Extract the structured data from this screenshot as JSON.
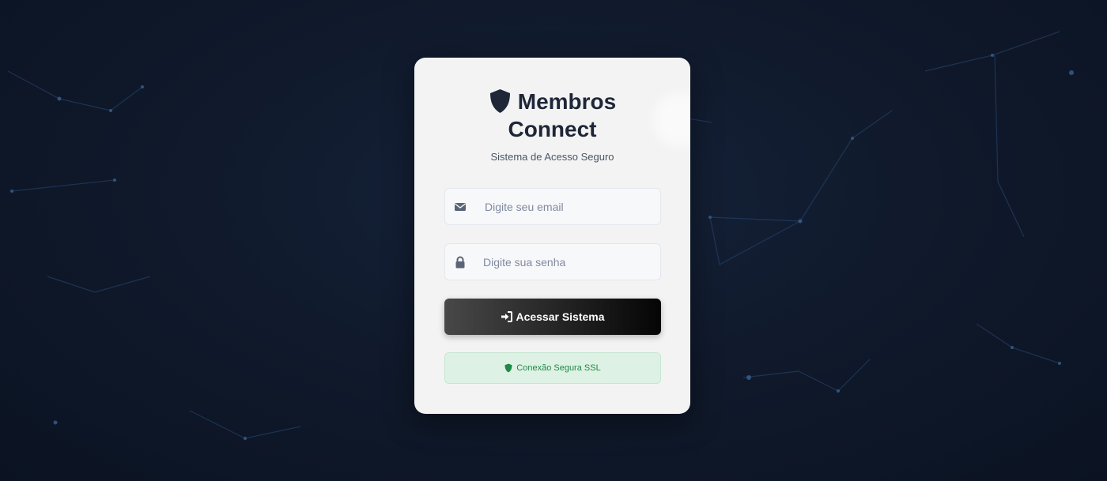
{
  "brand": {
    "title_line1": "Membros",
    "title_line2": "Connect",
    "subtitle": "Sistema de Acesso Seguro",
    "icon": "shield-icon"
  },
  "form": {
    "email": {
      "value": "",
      "placeholder": "Digite seu email",
      "icon": "envelope-icon"
    },
    "password": {
      "value": "",
      "placeholder": "Digite sua senha",
      "icon": "lock-icon"
    },
    "submit": {
      "label": "Acessar Sistema",
      "icon": "sign-in-icon"
    }
  },
  "security_badge": {
    "label": "Conexão Segura SSL",
    "icon": "shield-icon"
  },
  "colors": {
    "background": "#101a2c",
    "card": "#f3f3f3",
    "title": "#1e2638",
    "button_start": "#484848",
    "button_end": "#050505",
    "ssl_bg": "#def1e5",
    "ssl_text": "#1e8a45"
  }
}
